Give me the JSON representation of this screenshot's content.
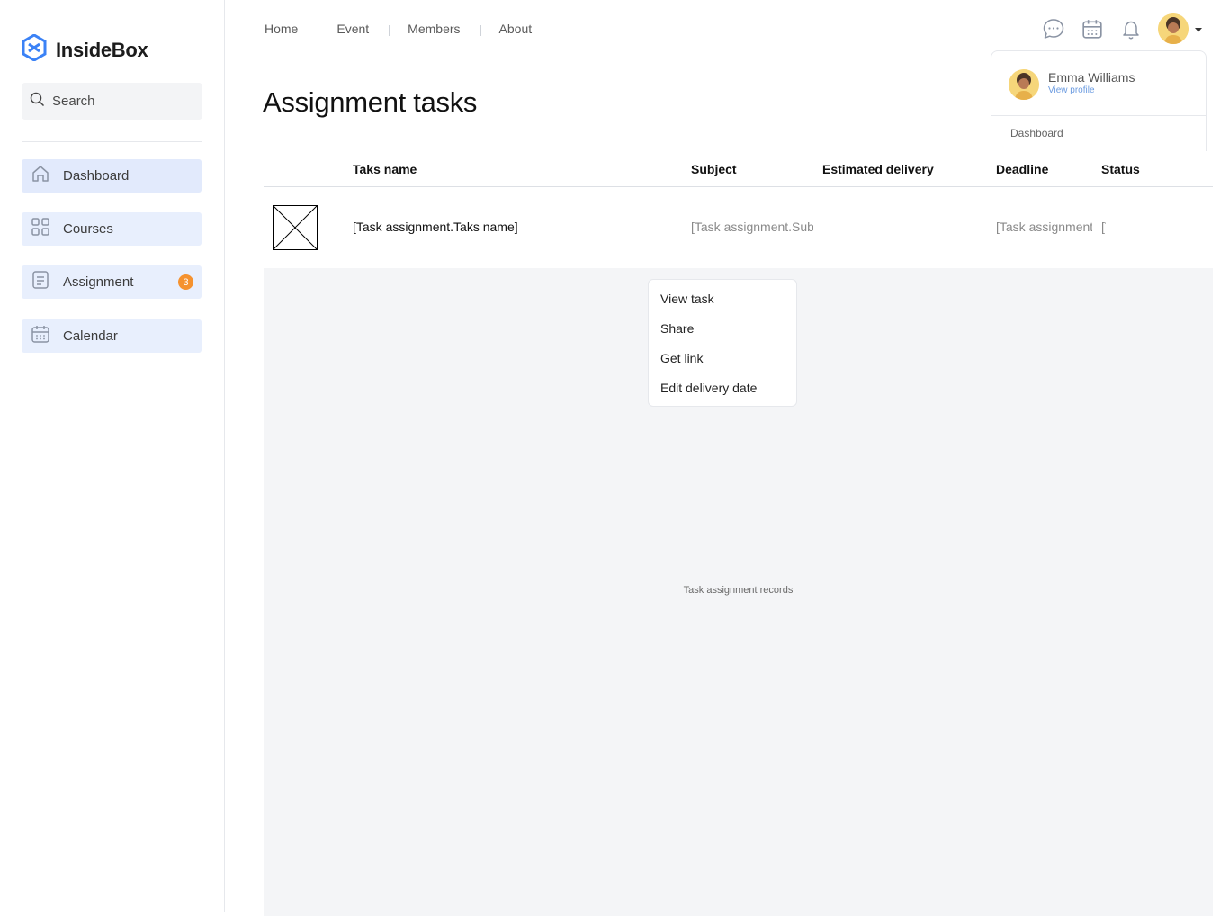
{
  "app": {
    "name": "InsideBox",
    "brand_color": "#3b82f6"
  },
  "sidebar": {
    "search_placeholder": "Search",
    "items": [
      {
        "label": "Dashboard",
        "icon": "home-icon"
      },
      {
        "label": "Courses",
        "icon": "grid-icon"
      },
      {
        "label": "Assignment",
        "icon": "document-icon",
        "badge": "3"
      },
      {
        "label": "Calendar",
        "icon": "calendar-icon"
      }
    ]
  },
  "topnav": {
    "links": [
      "Home",
      "Event",
      "Members",
      "About"
    ],
    "icons": [
      "chat-icon",
      "calendar-icon",
      "bell-icon"
    ]
  },
  "page": {
    "title": "Assignment tasks"
  },
  "table": {
    "columns": [
      "Taks name",
      "Subject",
      "Estimated delivery",
      "Deadline",
      "Status"
    ],
    "row": {
      "task_name": "[Task assignment.Taks name]",
      "subject": "[Task assignment.Subject]",
      "deadline": "[Task assignment.Deadline]",
      "status": "[Task assignment.Status]"
    },
    "records_label": "Task assignment records"
  },
  "context_menu": {
    "items": [
      "View task",
      "Share",
      "Get link",
      "Edit delivery date"
    ]
  },
  "profile": {
    "name": "Emma Williams",
    "link": "View profile",
    "menu_first": "Dashboard"
  },
  "colors": {
    "badge": "#f5922f",
    "nav_bg": "#e8effd",
    "records_bg": "#f4f5f7"
  }
}
